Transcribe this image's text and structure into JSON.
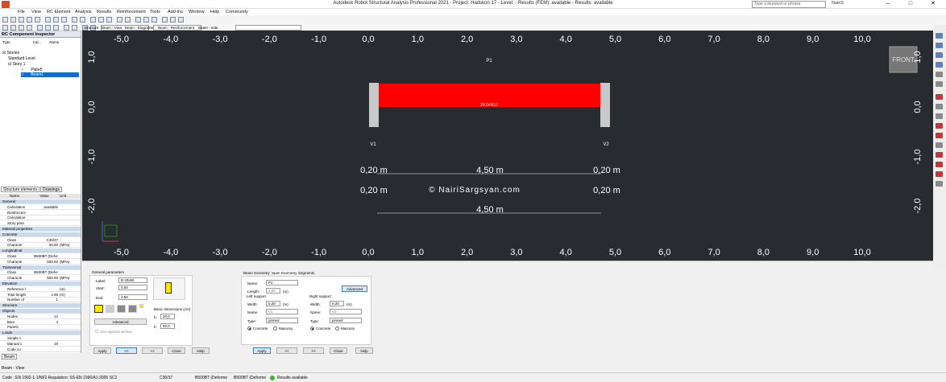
{
  "window": {
    "title": "Autodesk Robot Structural Analysis Professional 2021 - Project: Hadskon 17 - Level:  - Results (FEM): available - Results: available",
    "search_placeholder": "Type a keyword or phrase",
    "user": "NairiS"
  },
  "menu": [
    "File",
    "View",
    "RC Element",
    "Analysis",
    "Results",
    "Reinforcement",
    "Tools",
    "Add-Ins",
    "Window",
    "Help",
    "Community"
  ],
  "inspector": {
    "title": "RC Component Inspector",
    "headers": [
      "Type",
      "Cal...",
      "Name"
    ],
    "tree": [
      {
        "label": "Stories"
      },
      {
        "label": "Standard Level"
      },
      {
        "label": "Story 1"
      },
      {
        "label": "Plate5"
      },
      {
        "label": "Beam1"
      }
    ],
    "tabs": [
      "Structure elements",
      "Drawings"
    ],
    "prop_headers": [
      "Name",
      "Value",
      "Unit"
    ]
  },
  "props": [
    {
      "n": "General",
      "v": "",
      "u": "",
      "g": true
    },
    {
      "n": "Calculation",
      "v": "available",
      "u": ""
    },
    {
      "n": "Reinforcem",
      "v": "",
      "u": ""
    },
    {
      "n": "Calculation",
      "v": "",
      "u": ""
    },
    {
      "n": "Story para",
      "v": "",
      "u": ""
    },
    {
      "n": "Material properties",
      "v": "",
      "u": "",
      "g": true
    },
    {
      "n": "Concrete",
      "v": "",
      "u": "",
      "g": true
    },
    {
      "n": "Class",
      "v": "C30/37",
      "u": ""
    },
    {
      "n": "Characte",
      "v": "30.00",
      "u": "(MPa)"
    },
    {
      "n": "Longitudinal",
      "v": "",
      "u": "",
      "g": true
    },
    {
      "n": "Class",
      "v": "B500BT (Defor",
      "u": ""
    },
    {
      "n": "Characte",
      "v": "500.00",
      "u": "(MPa)"
    },
    {
      "n": "Transversal",
      "v": "",
      "u": "",
      "g": true
    },
    {
      "n": "Class",
      "v": "B500BT (Defor",
      "u": ""
    },
    {
      "n": "Characte",
      "v": "500.00",
      "u": "(MPa)"
    },
    {
      "n": "Elevation",
      "v": "",
      "u": "",
      "g": true
    },
    {
      "n": "Reference l",
      "v": "",
      "u": "(m)"
    },
    {
      "n": "Total length",
      "v": "4.95",
      "u": "(m)"
    },
    {
      "n": "Number of",
      "v": "1",
      "u": ""
    },
    {
      "n": "Structure",
      "v": "",
      "u": "",
      "g": true
    },
    {
      "n": "Objects",
      "v": "",
      "u": "",
      "g": true
    },
    {
      "n": "Nodes",
      "v": "12",
      "u": ""
    },
    {
      "n": "Bars",
      "v": "4",
      "u": ""
    },
    {
      "n": "Panels",
      "v": "",
      "u": ""
    },
    {
      "n": "Loads",
      "v": "",
      "u": "",
      "g": true
    },
    {
      "n": "Simple c",
      "v": "",
      "u": ""
    },
    {
      "n": "Manual c",
      "v": "19",
      "u": ""
    },
    {
      "n": "Code co",
      "v": "",
      "u": ""
    }
  ],
  "view_tabs": [
    "Structure",
    "Beam - View",
    "Beam - Diagrams",
    "Beam - Reinforcement",
    "Beam - note"
  ],
  "canvas": {
    "axis_labels": [
      "-5,0",
      "-4,0",
      "-3,0",
      "-2,0",
      "-1,0",
      "0,0",
      "1,0",
      "2,0",
      "3,0",
      "4,0",
      "5,0",
      "6,0",
      "7,0",
      "8,0",
      "9,0",
      "10,0"
    ],
    "v_labels": [
      "1,0",
      "0,0",
      "-1,0",
      "-2,0"
    ],
    "p1": "P1",
    "beam_label": "20,0x50,0",
    "v1": "V1",
    "v2": "V2",
    "dim_row1": [
      "0,20 m",
      "4,50 m",
      "0,20 m"
    ],
    "dim_row2": [
      "0,20 m",
      "0,20 m"
    ],
    "watermark": "© NairiSargsyan.com",
    "dim_total": "4,50 m",
    "front": "FRONT",
    "colors": {
      "beam": "#ff0000",
      "support": "#c8c8c8",
      "background": "#282b30"
    }
  },
  "general": {
    "title": "General parameters",
    "label_lbl": "Label:",
    "label_val": "B 20x50",
    "start_lbl": "Start:",
    "start_val": "0,00",
    "end_lbl": "End:",
    "end_val": "4,50",
    "advanced": "Advanced",
    "tapered": "Use tapered section",
    "basic": "Basic dimensions (cm)",
    "b_lbl": "b:",
    "b_val": "20,0",
    "h_lbl": "h:",
    "h_val": "50,0",
    "apply": "Apply",
    "prev": "<<",
    "next": ">>",
    "close": "Close",
    "help": "Help"
  },
  "span": {
    "tabs": [
      "Beam Geometry",
      "Span Geometry",
      "Segments"
    ],
    "name_lbl": "Name:",
    "name_val": "P1",
    "length_lbl": "Length:",
    "length_val": "4,50",
    "length_unit": "(m)",
    "advanced": "Advanced",
    "left": "Left support",
    "right": "Right support",
    "width_lbl": "Width:",
    "left_width": "0,20",
    "right_width": "0,20",
    "width_unit": "(m)",
    "sname_lbl": "Name:",
    "left_name": "V1",
    "right_name": "V2",
    "type_lbl": "Type:",
    "left_type": "pinned",
    "right_type": "pinned",
    "concrete": "Concrete",
    "masonry": "Masonry",
    "apply": "Apply",
    "prev": "<<",
    "next": ">>",
    "close": "Close",
    "help": "Help"
  },
  "bottom_tabs": [
    "Beam"
  ],
  "bottom_view": "Beam - View",
  "status": {
    "code": "Code : EN 1992-1-1/NF2 Regulation: SS-EN 1990/A1:2005 SC2",
    "concrete": "C30/37",
    "steel1": "B500BT (Deforme",
    "steel2": "B500BT (Deforme",
    "results": "Results available"
  }
}
